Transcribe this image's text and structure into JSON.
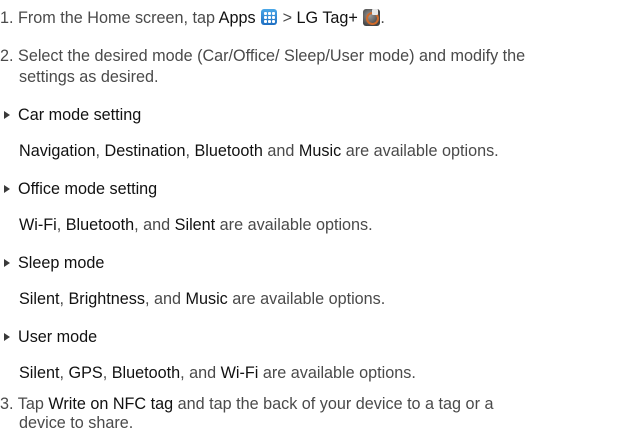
{
  "steps": [
    {
      "number": "1.",
      "text1": "From the Home screen, tap",
      "apps": "Apps",
      "gt": ">",
      "lgtag": "LG Tag+",
      "period": "."
    },
    {
      "number": "2.",
      "line1": "Select the desired mode (Car/Office/ Sleep/User mode) and modify the",
      "line2": "settings as desired."
    },
    {
      "number": "3.",
      "text1": "Tap",
      "write": "Write on NFC tag",
      "text2": "and tap the back of your device to a tag or a",
      "line2": "device to share."
    }
  ],
  "modes": [
    {
      "title": "Car mode setting",
      "options": [
        "Navigation",
        "Destination",
        "Bluetooth",
        "Music"
      ],
      "seps": [
        ", ",
        ", ",
        " and "
      ],
      "suffix": " are available options."
    },
    {
      "title": "Office mode setting",
      "options": [
        "Wi-Fi",
        "Bluetooth",
        "Silent"
      ],
      "seps": [
        ", ",
        ", and "
      ],
      "suffix": " are available options."
    },
    {
      "title": "Sleep mode",
      "options": [
        "Silent",
        "Brightness",
        "Music"
      ],
      "seps": [
        ", ",
        ", and "
      ],
      "suffix": " are available options."
    },
    {
      "title": "User mode",
      "options": [
        "Silent",
        "GPS",
        "Bluetooth",
        "Wi-Fi"
      ],
      "seps": [
        ", ",
        ", ",
        ", and "
      ],
      "suffix": " are available options."
    }
  ],
  "icons": {
    "apps_icon": "apps-grid-icon",
    "lgtag_icon": "lg-tag-plus-icon"
  }
}
